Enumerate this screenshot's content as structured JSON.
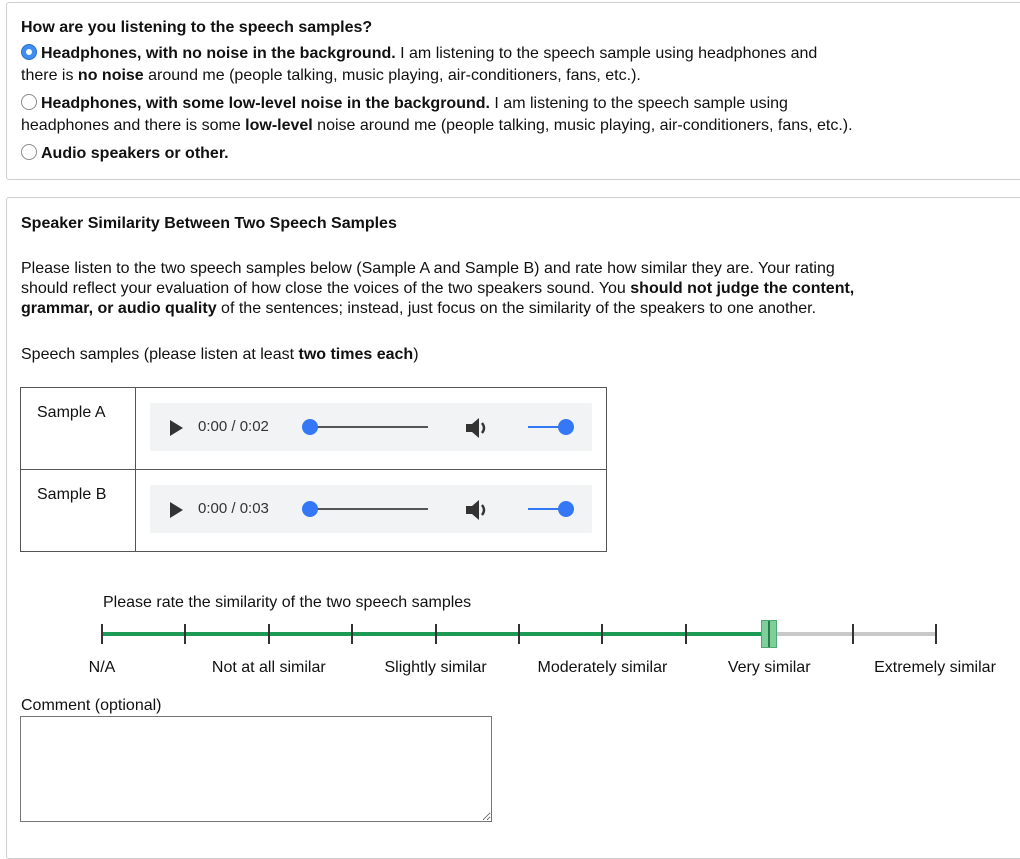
{
  "listening": {
    "question": "How are you listening to the speech samples?",
    "options": [
      {
        "selected": true,
        "line1_bold": "Headphones, with no noise in the background.",
        "line1_rest": " I am listening to the speech sample using headphones and",
        "line2_pre": "there is ",
        "line2_bold": "no noise",
        "line2_rest": " around me (people talking, music playing, air-conditioners, fans, etc.)."
      },
      {
        "selected": false,
        "line1_bold": "Headphones, with some low-level noise in the background.",
        "line1_rest": " I am listening to the speech sample using",
        "line2_pre": "headphones and there is some ",
        "line2_bold": "low-level",
        "line2_rest": " noise around me (people talking, music playing, air-conditioners, fans, etc.)."
      },
      {
        "selected": false,
        "line1_bold": "Audio speakers or other."
      }
    ]
  },
  "similarity": {
    "title": "Speaker Similarity Between Two Speech Samples",
    "instructions": {
      "line1": "Please listen to the two speech samples below (Sample A and Sample B) and rate how similar they are. Your rating",
      "line2_pre": "should reflect your evaluation of how close the voices of the two speakers sound. You ",
      "line2_bold": "should not judge the content,",
      "line3_bold": "grammar, or audio quality",
      "line3_rest": " of the sentences; instead, just focus on the similarity of the speakers to one another."
    },
    "samples_intro_pre": "Speech samples (please listen at least ",
    "samples_intro_bold": "two times each",
    "samples_intro_post": ")",
    "samples": [
      {
        "label": "Sample A",
        "time": "0:00 / 0:02",
        "progress": 0,
        "volume": 1
      },
      {
        "label": "Sample B",
        "time": "0:00 / 0:03",
        "progress": 0,
        "volume": 1
      }
    ],
    "rating": {
      "prompt": "Please rate the similarity of the two speech samples",
      "labels": [
        "N/A",
        "Not at all similar",
        "Slightly similar",
        "Moderately similar",
        "Very similar",
        "Extremely similar"
      ],
      "value_fraction": 0.8
    },
    "comment": {
      "label": "Comment (optional)",
      "value": ""
    }
  },
  "colors": {
    "accent_blue": "#3478f6",
    "rating_green": "#1d9a55",
    "rating_grey": "#c8c8c8"
  }
}
